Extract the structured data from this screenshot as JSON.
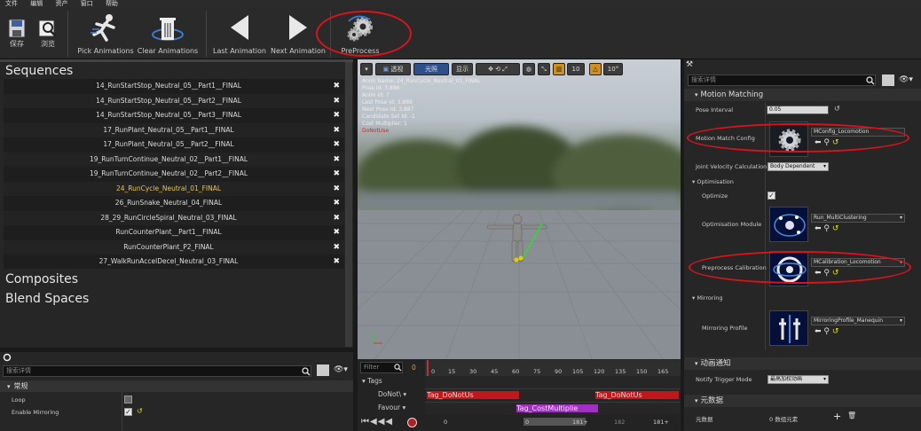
{
  "menu": [
    "文件",
    "编辑",
    "资产",
    "窗口",
    "帮助"
  ],
  "toolbar": {
    "save": "保存",
    "browse": "浏览",
    "pick_animations": "Pick Animations",
    "clear_animations": "Clear Animations",
    "last_animation": "Last Animation",
    "next_animation": "Next Animation",
    "preprocess": "PreProcess"
  },
  "left": {
    "sequences_title": "Sequences",
    "sequences": [
      "14_RunStartStop_Neutral_05__Part1__FINAL",
      "14_RunStartStop_Neutral_05__Part2__FINAL",
      "14_RunStartStop_Neutral_05__Part3__FINAL",
      "17_RunPlant_Neutral_05__Part1__FINAL",
      "17_RunPlant_Neutral_05__Part2__FINAL",
      "19_RunTurnContinue_Neutral_02__Part1__FINAL",
      "19_RunTurnContinue_Neutral_02__Part2__FINAL",
      "24_RunCycle_Neutral_01_FINAL",
      "26_RunSnake_Neutral_04_FINAL",
      "28_29_RunCircleSpiral_Neutral_03_FINAL",
      "RunCounterPlant__Part1__FINAL",
      "RunCounterPlant_P2_FINAL",
      "27_WalkRunAccelDecel_Neutral_03_FINAL"
    ],
    "selected_index": 7,
    "composites_title": "Composites",
    "blend_spaces_title": "Blend Spaces"
  },
  "details": {
    "search_placeholder": "搜索详情",
    "category": "常规",
    "loop_label": "Loop",
    "enable_mirroring_label": "Enable Mirroring",
    "loop_checked": false,
    "enable_mirroring_checked": true
  },
  "viewport": {
    "perspective_btn": "透视",
    "lighting_btn": "光照",
    "show_btn": "显示",
    "grid_value": "10",
    "angle_value": "10°",
    "info": [
      "Anim Name: 24_RunCycle_Neutral_01_FINAL",
      "Pose Id: 3,886",
      "Anim Id: 7",
      "Last Pose Id: 3,886",
      "Next Pose Id: 3,887",
      "Candidate Set Id: -1",
      "Cost Multiplier: 1"
    ],
    "warning": "DoNotUse"
  },
  "timeline": {
    "filter_placeholder": "Filter",
    "current_frame": "0",
    "ruler": [
      "0",
      "15",
      "30",
      "45",
      "60",
      "75",
      "90",
      "105",
      "120",
      "135",
      "150",
      "165"
    ],
    "tracks": [
      "Tags",
      "DoNot\\",
      "Favour"
    ],
    "notify1": "Tag_DoNotUs",
    "notify2": "Tag_DoNotUs",
    "notify3": "Tag_CostMultiplie",
    "bottom_start": "0",
    "bottom_current": "0",
    "bottom_end1": "181+",
    "bottom_end2": "182",
    "bottom_end3": "181+"
  },
  "right": {
    "search_placeholder": "搜索详情",
    "motion_matching": "Motion Matching",
    "pose_interval_label": "Pose Interval",
    "pose_interval_value": "0.05",
    "motion_match_config_label": "Motion Match Config",
    "motion_match_config_value": "MConfig_Locomotion",
    "joint_velocity_label": "Joint Velocity Calculation",
    "joint_velocity_value": "Body Dependent",
    "optimisation": "Optimisation",
    "optimize_label": "Optimize",
    "optimize_checked": true,
    "optimisation_module_label": "Optimisation Module",
    "optimisation_module_value": "Run_MultiClustering",
    "preprocess_calibration_label": "Preprocess Calibration",
    "preprocess_calibration_value": "MCalibration_Locomotion",
    "mirroring": "Mirroring",
    "mirroring_profile_label": "Mirroring Profile",
    "mirroring_profile_value": "MirroringProfile_Manequin",
    "anim_notify": "动画通知",
    "notify_trigger_label": "Notify Trigger Mode",
    "notify_trigger_value": "最高加权动画",
    "metadata": "元数据",
    "metadata_label": "元数据",
    "metadata_value": "0 数组元素"
  },
  "colors": {
    "annotation": "#d8141a",
    "notify_red": "#c0181a",
    "notify_purple": "#a030c0",
    "selected_text": "#e8c840"
  }
}
